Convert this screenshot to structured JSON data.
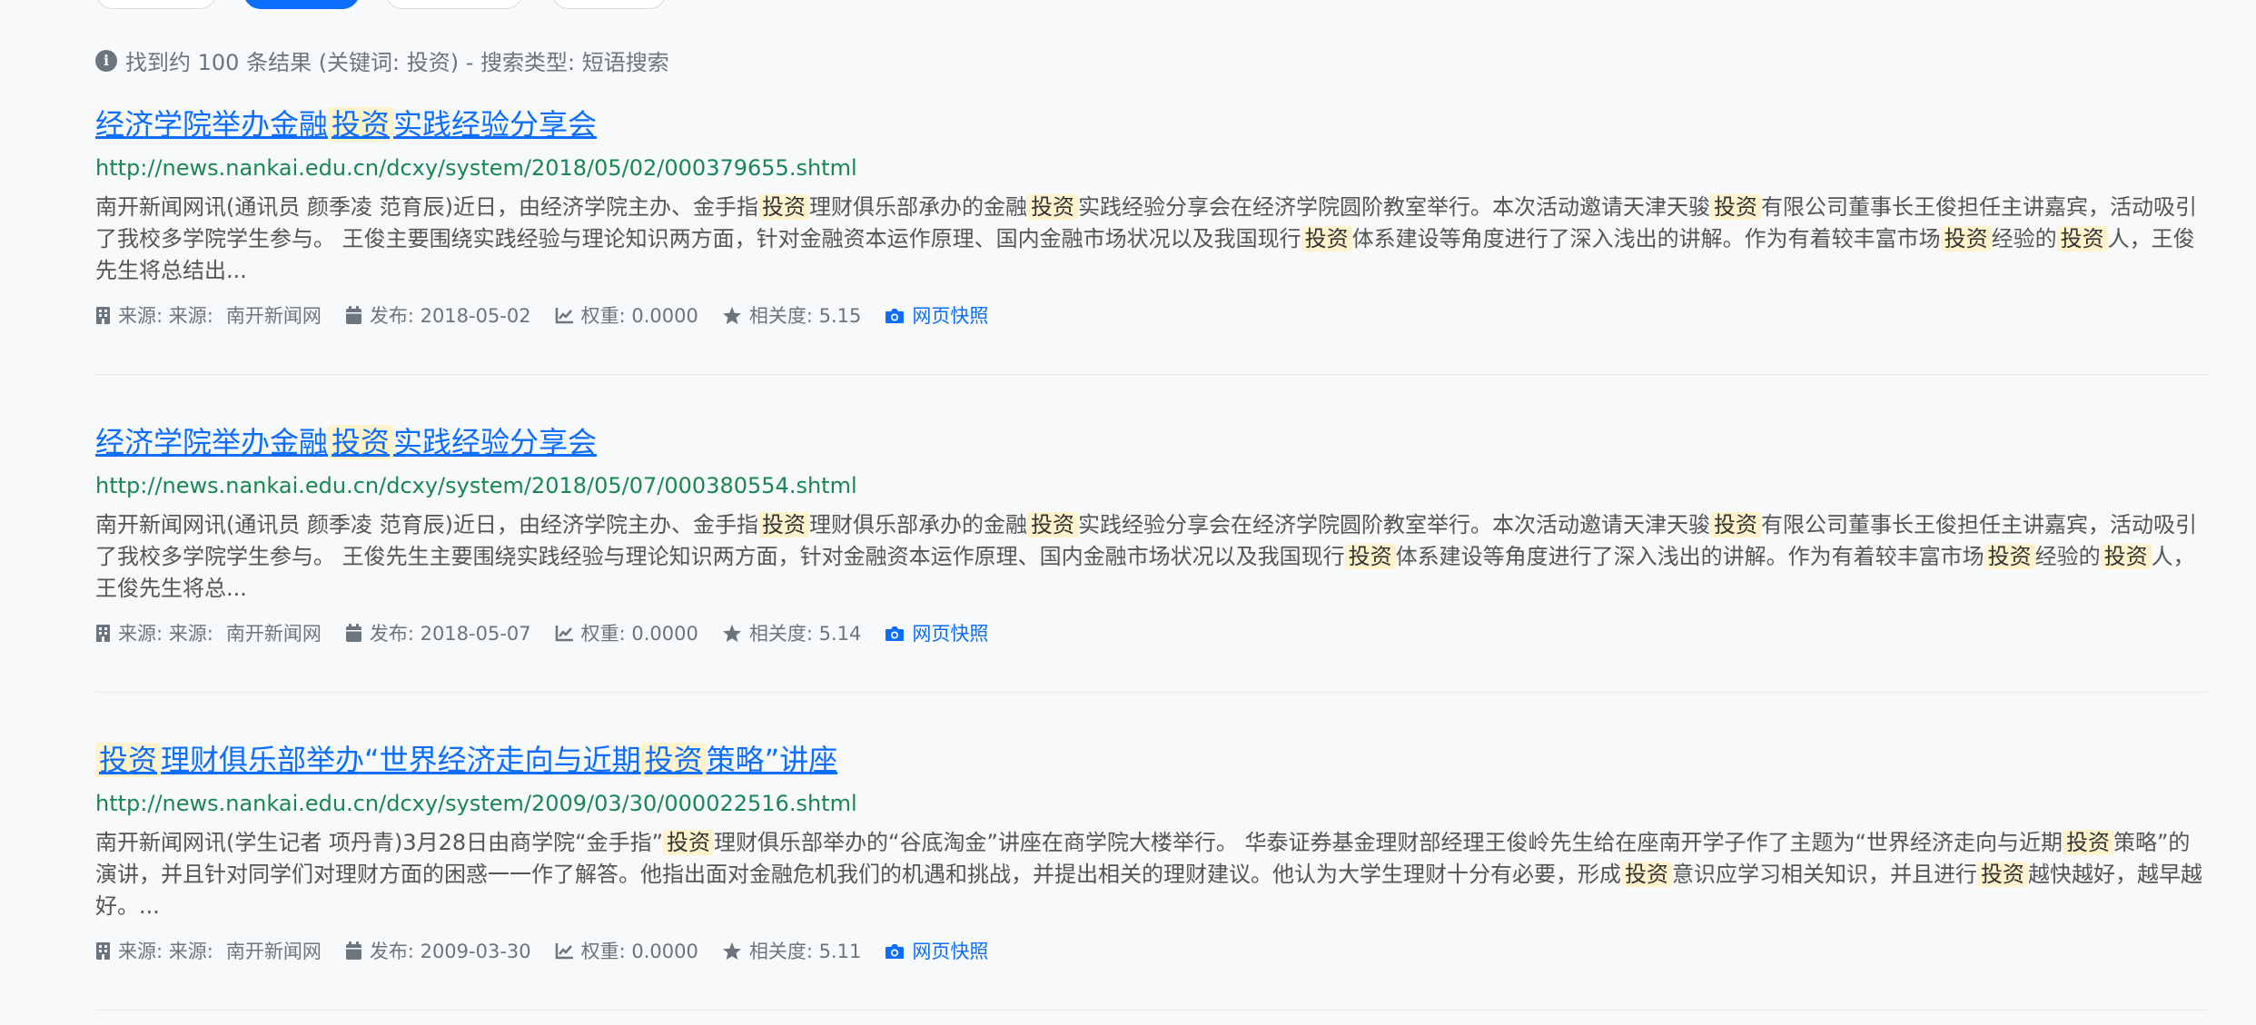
{
  "summary": {
    "icon": "info-icon",
    "text": "找到约 100 条结果 (关键词: 投资) - 搜索类型: 短语搜索"
  },
  "results": [
    {
      "title_parts": [
        {
          "t": "经济学院举办金融",
          "h": false
        },
        {
          "t": "投资",
          "h": true
        },
        {
          "t": "实践经验分享会",
          "h": false
        }
      ],
      "url": "http://news.nankai.edu.cn/dcxy/system/2018/05/02/000379655.shtml",
      "snippet_parts": [
        {
          "t": "南开新闻网讯(通讯员 颜季凌 范育辰)近日，由经济学院主办、金手指",
          "h": false
        },
        {
          "t": "投资",
          "h": true
        },
        {
          "t": "理财俱乐部承办的金融",
          "h": false
        },
        {
          "t": "投资",
          "h": true
        },
        {
          "t": "实践经验分享会在经济学院圆阶教室举行。本次活动邀请天津天骏",
          "h": false
        },
        {
          "t": "投资",
          "h": true
        },
        {
          "t": "有限公司董事长王俊担任主讲嘉宾，活动吸引了我校多学院学生参与。 王俊主要围绕实践经验与理论知识两方面，针对金融资本运作原理、国内金融市场状况以及我国现行",
          "h": false
        },
        {
          "t": "投资",
          "h": true
        },
        {
          "t": "体系建设等角度进行了深入浅出的讲解。作为有着较丰富市场",
          "h": false
        },
        {
          "t": "投资",
          "h": true
        },
        {
          "t": "经验的",
          "h": false
        },
        {
          "t": "投资",
          "h": true
        },
        {
          "t": "人，王俊先生将总结出...",
          "h": false
        }
      ],
      "source_label": "来源: 来源:",
      "source": "南开新闻网",
      "publish": "发布: 2018-05-02",
      "weight": "权重: 0.0000",
      "relevance": "相关度: 5.15",
      "snapshot": "网页快照"
    },
    {
      "title_parts": [
        {
          "t": "经济学院举办金融",
          "h": false
        },
        {
          "t": "投资",
          "h": true
        },
        {
          "t": "实践经验分享会",
          "h": false
        }
      ],
      "url": "http://news.nankai.edu.cn/dcxy/system/2018/05/07/000380554.shtml",
      "snippet_parts": [
        {
          "t": "南开新闻网讯(通讯员 颜季凌 范育辰)近日，由经济学院主办、金手指",
          "h": false
        },
        {
          "t": "投资",
          "h": true
        },
        {
          "t": "理财俱乐部承办的金融",
          "h": false
        },
        {
          "t": "投资",
          "h": true
        },
        {
          "t": "实践经验分享会在经济学院圆阶教室举行。本次活动邀请天津天骏",
          "h": false
        },
        {
          "t": "投资",
          "h": true
        },
        {
          "t": "有限公司董事长王俊担任主讲嘉宾，活动吸引了我校多学院学生参与。 王俊先生主要围绕实践经验与理论知识两方面，针对金融资本运作原理、国内金融市场状况以及我国现行",
          "h": false
        },
        {
          "t": "投资",
          "h": true
        },
        {
          "t": "体系建设等角度进行了深入浅出的讲解。作为有着较丰富市场",
          "h": false
        },
        {
          "t": "投资",
          "h": true
        },
        {
          "t": "经验的",
          "h": false
        },
        {
          "t": "投资",
          "h": true
        },
        {
          "t": "人，王俊先生将总...",
          "h": false
        }
      ],
      "source_label": "来源: 来源:",
      "source": "南开新闻网",
      "publish": "发布: 2018-05-07",
      "weight": "权重: 0.0000",
      "relevance": "相关度: 5.14",
      "snapshot": "网页快照"
    },
    {
      "title_parts": [
        {
          "t": "投资",
          "h": true
        },
        {
          "t": "理财俱乐部举办“世界经济走向与近期",
          "h": false
        },
        {
          "t": "投资",
          "h": true
        },
        {
          "t": "策略”讲座",
          "h": false
        }
      ],
      "url": "http://news.nankai.edu.cn/dcxy/system/2009/03/30/000022516.shtml",
      "snippet_parts": [
        {
          "t": "南开新闻网讯(学生记者 项丹青)3月28日由商学院“金手指”",
          "h": false
        },
        {
          "t": "投资",
          "h": true
        },
        {
          "t": "理财俱乐部举办的“谷底淘金”讲座在商学院大楼举行。 华泰证券基金理财部经理王俊岭先生给在座南开学子作了主题为“世界经济走向与近期",
          "h": false
        },
        {
          "t": "投资",
          "h": true
        },
        {
          "t": "策略”的演讲，并且针对同学们对理财方面的困惑一一作了解答。他指出面对金融危机我们的机遇和挑战，并提出相关的理财建议。他认为大学生理财十分有必要，形成",
          "h": false
        },
        {
          "t": "投资",
          "h": true
        },
        {
          "t": "意识应学习相关知识，并且进行",
          "h": false
        },
        {
          "t": "投资",
          "h": true
        },
        {
          "t": "越快越好，越早越好。...",
          "h": false
        }
      ],
      "source_label": "来源: 来源:",
      "source": "南开新闻网",
      "publish": "发布: 2009-03-30",
      "weight": "权重: 0.0000",
      "relevance": "相关度: 5.11",
      "snapshot": "网页快照"
    }
  ],
  "icons": {
    "source": "building-icon",
    "publish": "calendar-icon",
    "weight": "chart-line-icon",
    "relevance": "star-icon",
    "snapshot": "camera-icon"
  },
  "colors": {
    "link": "#0d6efd",
    "url": "#198754",
    "highlight": "#fff3cd",
    "muted": "#6c757d",
    "background": "#f8f9fa"
  }
}
